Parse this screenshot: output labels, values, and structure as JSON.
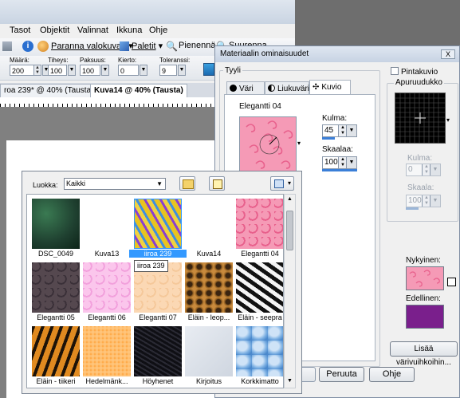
{
  "menu": [
    "Tasot",
    "Objektit",
    "Valinnat",
    "Ikkuna",
    "Ohje"
  ],
  "toolbar": {
    "enhance": "Paranna valokuvaa",
    "palettes": "Paletit",
    "zoom_out": "Pienennä",
    "zoom_in": "Suurenna"
  },
  "options": [
    {
      "label": "Määrä:",
      "value": "200"
    },
    {
      "label": "Tiheys:",
      "value": "100"
    },
    {
      "label": "Paksuus:",
      "value": "100"
    },
    {
      "label": "Kierto:",
      "value": "0"
    },
    {
      "label": "Toleranssi:",
      "value": "9"
    }
  ],
  "doc_tabs": [
    "roa 239* @ 40% (Tausta)",
    "Kuva14 @ 40% (Tausta)"
  ],
  "dialog": {
    "title": "Materiaalin ominaisuudet",
    "close": "X",
    "style_group": "Tyyli",
    "tabs": [
      "Väri",
      "Liukuväri",
      "Kuvio"
    ],
    "pattern_name": "Elegantti 04",
    "angle_label": "Kulma:",
    "angle_value": "45",
    "scale_label": "Skaalaa:",
    "scale_value": "100",
    "pattern_check": "Pintakuvio",
    "texture_group": "Apuruudukko",
    "angle2_label": "Kulma:",
    "angle2_value": "0",
    "scale2_label": "Skaala:",
    "scale2_value": "100",
    "current_label": "Nykyinen:",
    "previous_label": "Edellinen:",
    "add_swatch": "Lisää värivuihkoihin...",
    "cancel": "Peruuta",
    "help": "Ohje"
  },
  "picker": {
    "category_label": "Luokka:",
    "category_value": "Kaikki",
    "tooltip": "iiroa 239",
    "items": [
      {
        "label": "DSC_0049"
      },
      {
        "label": "Kuva13"
      },
      {
        "label": "iiroa 239",
        "selected": true
      },
      {
        "label": "Kuva14"
      },
      {
        "label": "Elegantti 04"
      },
      {
        "label": "Elegantti 05"
      },
      {
        "label": "Elegantti 06"
      },
      {
        "label": "Elegantti 07"
      },
      {
        "label": "Eläin - leop..."
      },
      {
        "label": "Eläin - seepra"
      },
      {
        "label": "Eläin - tiikeri"
      },
      {
        "label": "Hedelmänk..."
      },
      {
        "label": "Höyhenet"
      },
      {
        "label": "Kirjoitus"
      },
      {
        "label": "Korkkimatto"
      }
    ]
  },
  "colors": {
    "current_swatch": "#f08aa6",
    "previous_swatch": "#7a1f8c",
    "selection_blue": "#3399ff"
  }
}
